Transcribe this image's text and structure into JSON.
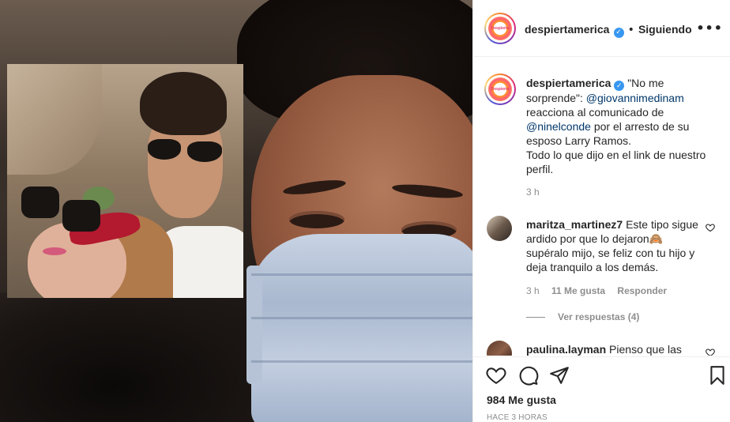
{
  "post": {
    "author": "despiertamerica",
    "follow_status": "Siguiendo",
    "more_glyph": "•••",
    "logo_text": "Despierta",
    "caption": {
      "username": "despiertamerica",
      "part1": "\"No me sorprende\": ",
      "mention1": "@giovannimedinam",
      "part2": " reacciona al comunicado de ",
      "mention2": "@ninelconde",
      "part3": " por el arresto de su esposo Larry Ramos.",
      "line2": "Todo lo que dijo en el link de nuestro perfil.",
      "time": "3 h"
    },
    "comments": [
      {
        "username": "maritza_martinez7",
        "text": "Este tipo sigue ardido por que lo dejaron🙈 supéralo mijo, se feliz con tu hijo y deja tranquilo a los demás.",
        "time": "3 h",
        "likes": "11 Me gusta",
        "reply": "Responder",
        "view_replies": "Ver respuestas (4)"
      },
      {
        "username": "paulina.layman",
        "text": "Pienso que las"
      }
    ],
    "likes_count": "984 Me gusta",
    "posted_ago": "HACE 3 HORAS"
  },
  "icons": {
    "verified": "verified-badge-icon",
    "heart": "heart-icon",
    "comment": "comment-icon",
    "share": "share-icon",
    "save": "bookmark-icon"
  },
  "colors": {
    "text": "#262626",
    "muted": "#8e8e8e",
    "mention": "#00376b",
    "verified": "#3897f0",
    "border": "#efefef"
  }
}
